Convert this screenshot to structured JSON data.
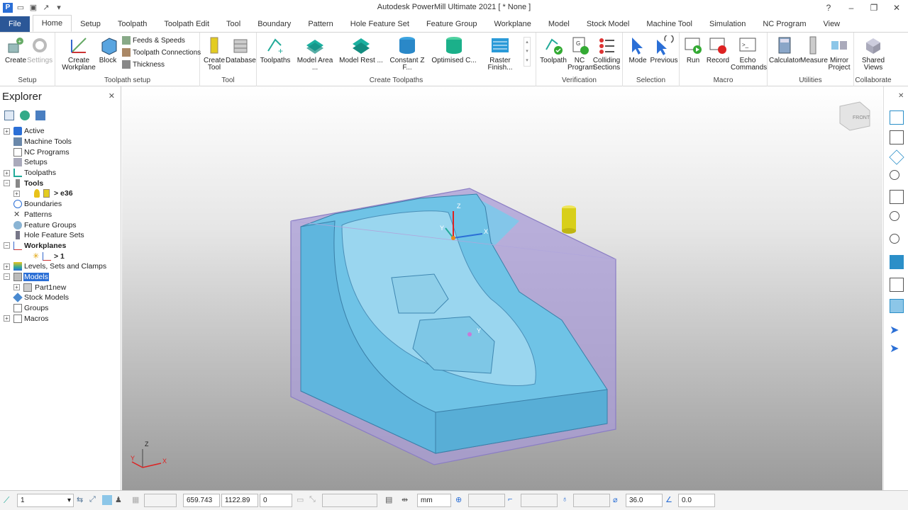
{
  "app": {
    "title": "Autodesk PowerMill Ultimate 2021   [ * None ]"
  },
  "tabs": [
    "File",
    "Home",
    "Setup",
    "Toolpath",
    "Toolpath Edit",
    "Tool",
    "Boundary",
    "Pattern",
    "Hole Feature Set",
    "Feature Group",
    "Workplane",
    "Model",
    "Stock Model",
    "Machine Tool",
    "Simulation",
    "NC Program",
    "View"
  ],
  "ribbon": {
    "setup": {
      "label": "Setup",
      "create": "Create",
      "settings": "Settings"
    },
    "toolpath_setup": {
      "label": "Toolpath setup",
      "create_workplane": "Create Workplane",
      "block": "Block",
      "feeds": "Feeds & Speeds",
      "connections": "Toolpath Connections",
      "thickness": "Thickness"
    },
    "tool": {
      "label": "Tool",
      "create_tool": "Create Tool",
      "database": "Database"
    },
    "create_toolpaths": {
      "label": "Create Toolpaths",
      "toolpaths": "Toolpaths",
      "items": [
        "Model Area ...",
        "Model Rest ...",
        "Constant Z F...",
        "Optimised C...",
        "Raster Finish..."
      ]
    },
    "verification": {
      "label": "Verification",
      "toolpath": "Toolpath",
      "nc_program": "NC Program",
      "colliding": "Colliding Sections"
    },
    "selection": {
      "label": "Selection",
      "mode": "Mode",
      "previous": "Previous"
    },
    "macro": {
      "label": "Macro",
      "run": "Run",
      "record": "Record",
      "echo": "Echo Commands"
    },
    "utilities": {
      "label": "Utilities",
      "calculator": "Calculator",
      "measure": "Measure",
      "mirror": "Mirror Project"
    },
    "collaborate": {
      "label": "Collaborate",
      "shared": "Shared Views"
    }
  },
  "explorer": {
    "title": "Explorer",
    "nodes": [
      {
        "label": "Active",
        "expander": "+"
      },
      {
        "label": "Machine Tools",
        "expander": ""
      },
      {
        "label": "NC Programs",
        "expander": ""
      },
      {
        "label": "Setups",
        "expander": ""
      },
      {
        "label": "Toolpaths",
        "expander": "+"
      },
      {
        "label": "Tools",
        "expander": "−"
      },
      {
        "label": "> e36",
        "expander": "+"
      },
      {
        "label": "Boundaries",
        "expander": ""
      },
      {
        "label": "Patterns",
        "expander": ""
      },
      {
        "label": "Feature Groups",
        "expander": ""
      },
      {
        "label": "Hole Feature Sets",
        "expander": ""
      },
      {
        "label": "Workplanes",
        "expander": "−"
      },
      {
        "label": "> 1",
        "expander": ""
      },
      {
        "label": "Levels, Sets and Clamps",
        "expander": "+"
      },
      {
        "label": "Models",
        "expander": "−"
      },
      {
        "label": "Part1new",
        "expander": "+"
      },
      {
        "label": "Stock Models",
        "expander": ""
      },
      {
        "label": "Groups",
        "expander": ""
      },
      {
        "label": "Macros",
        "expander": "+"
      }
    ]
  },
  "viewport": {
    "cube_label": "FRONT",
    "axis_x": "X",
    "axis_y": "Y",
    "axis_z": "Z",
    "wp_x": "X",
    "wp_y": "Y",
    "wp_z": "Z"
  },
  "status": {
    "layer": "1",
    "x": "659.743",
    "y": "1122.89",
    "z": "0",
    "units": "mm",
    "diameter": "36.0",
    "angle": "0.0"
  },
  "colors": {
    "file_tab": "#2b5797",
    "selection": "#2b6fd6",
    "model": "#6fc3e6",
    "block": "#a89bd6",
    "tool": "#d8cf1a"
  }
}
